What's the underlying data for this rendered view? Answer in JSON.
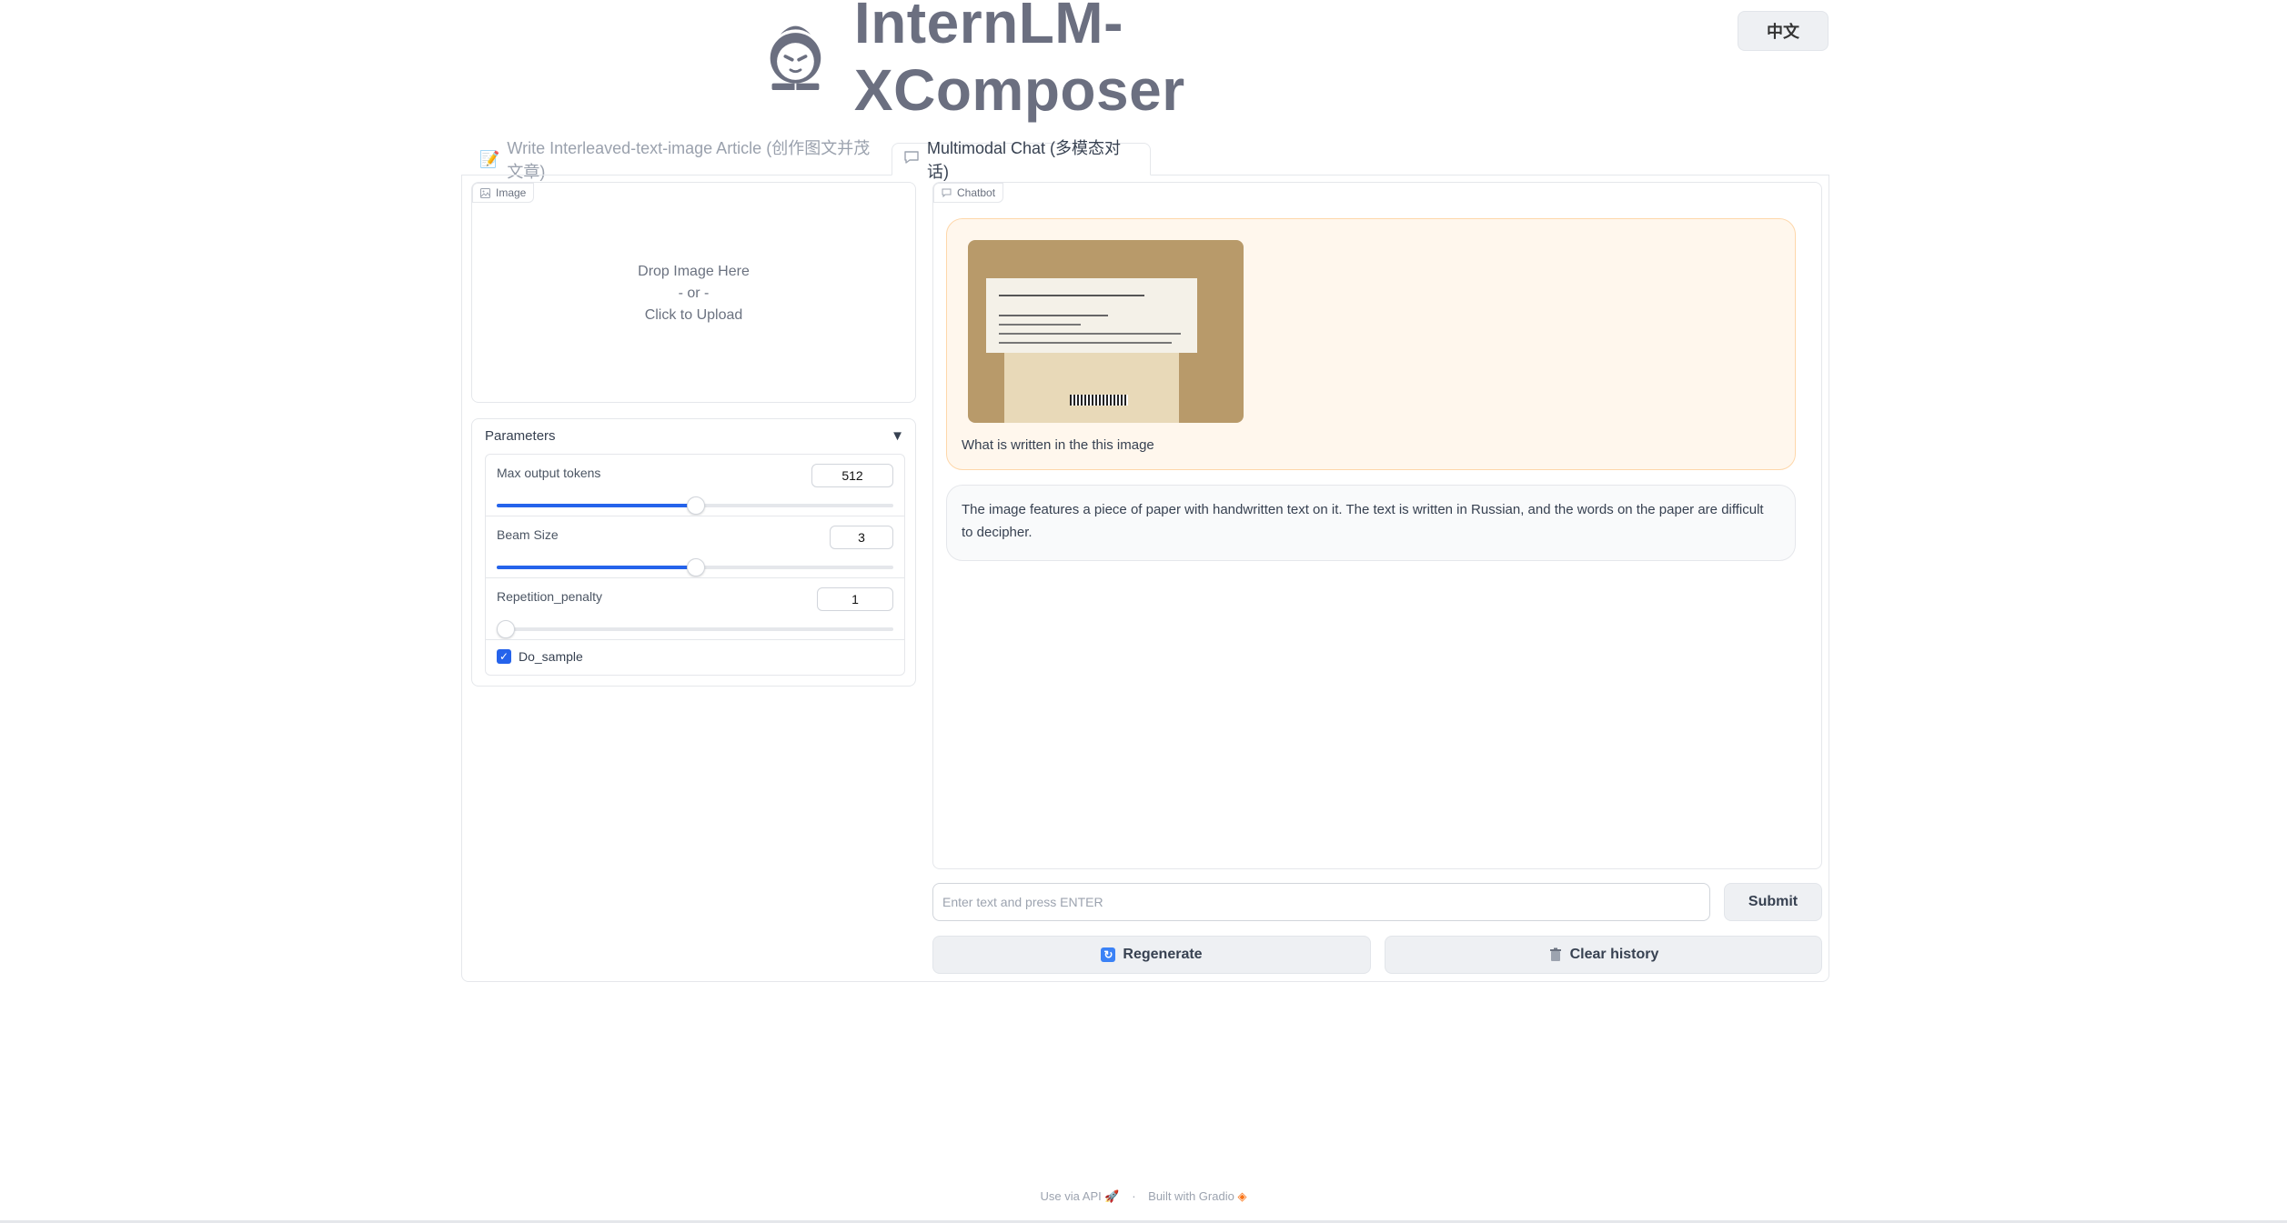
{
  "header": {
    "title": "InternLM-XComposer",
    "lang_button": "中文"
  },
  "tabs": [
    {
      "label": "Write Interleaved-text-image Article (创作图文并茂文章)",
      "active": false
    },
    {
      "label": "Multimodal Chat (多模态对话)",
      "active": true
    }
  ],
  "image_panel": {
    "label": "Image",
    "drop_text": "Drop Image Here",
    "or_text": "- or -",
    "click_text": "Click to Upload"
  },
  "parameters": {
    "title": "Parameters",
    "collapse_symbol": "▼",
    "max_tokens": {
      "label": "Max output tokens",
      "value": "512",
      "fill_percent": 50
    },
    "beam_size": {
      "label": "Beam Size",
      "value": "3",
      "fill_percent": 50
    },
    "repetition_penalty": {
      "label": "Repetition_penalty",
      "value": "1",
      "fill_percent": 0
    },
    "do_sample": {
      "label": "Do_sample",
      "checked": true
    }
  },
  "chatbot": {
    "label": "Chatbot",
    "user_message": "What is written in the this image",
    "bot_message": "The image features a piece of paper with handwritten text on it. The text is written in Russian, and the words on the paper are difficult to decipher."
  },
  "input": {
    "placeholder": "Enter text and press ENTER",
    "submit_label": "Submit",
    "regenerate_label": "Regenerate",
    "clear_label": "Clear history"
  },
  "footer": {
    "api_text": "Use via API",
    "separator": "·",
    "built_text": "Built with Gradio"
  },
  "colors": {
    "accent": "#2563eb",
    "user_bubble": "#fff7ed",
    "title": "#6b6f80"
  }
}
